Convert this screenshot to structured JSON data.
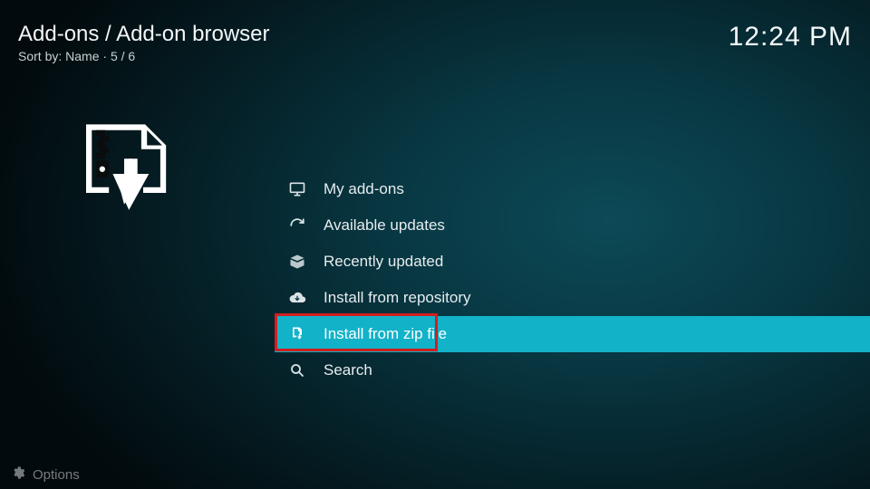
{
  "header": {
    "breadcrumb": "Add-ons / Add-on browser",
    "sort_prefix": "Sort by:",
    "sort_value": "Name",
    "counter": "5 / 6"
  },
  "clock": "12:24 PM",
  "menu": {
    "selected_index": 4,
    "items": [
      {
        "label": "My add-ons",
        "icon": "monitor-icon"
      },
      {
        "label": "Available updates",
        "icon": "refresh-icon"
      },
      {
        "label": "Recently updated",
        "icon": "box-open-icon"
      },
      {
        "label": "Install from repository",
        "icon": "cloud-download-icon"
      },
      {
        "label": "Install from zip file",
        "icon": "zip-download-icon"
      },
      {
        "label": "Search",
        "icon": "search-icon"
      }
    ]
  },
  "options_label": "Options",
  "highlight_color": "#d11e1e",
  "accent_color": "#12b2c9"
}
